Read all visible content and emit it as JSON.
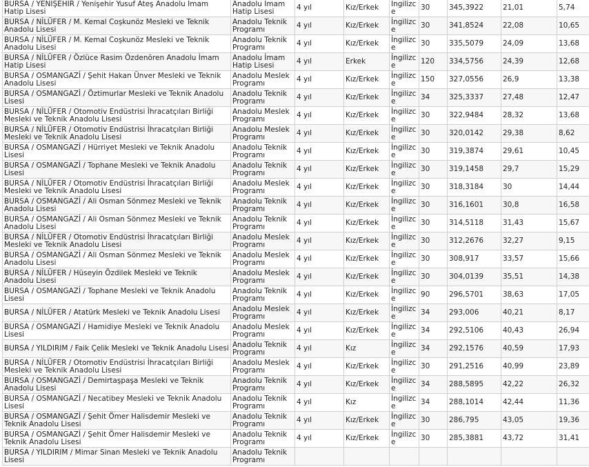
{
  "rows": [
    {
      "school": "BURSA / YENİŞEHİR / Yenişehir Yusuf Ateş Anadolu İmam Hatip Lisesi",
      "type": "Anadolu İmam Hatip Lisesi",
      "duration": "4 yıl",
      "gender": "Kız/Erkek",
      "language": "İngilizce",
      "quota": "30",
      "score": "345,3922",
      "pct1": "21,01",
      "pct2": "5,74"
    },
    {
      "school": "BURSA / NİLÜFER / M. Kemal Coşkunöz Mesleki ve Teknik Anadolu Lisesi",
      "type": "Anadolu Teknik Programı",
      "duration": "4 yıl",
      "gender": "Kız/Erkek",
      "language": "İngilizce",
      "quota": "30",
      "score": "341,8524",
      "pct1": "22,08",
      "pct2": "10,65"
    },
    {
      "school": "BURSA / NİLÜFER / M. Kemal Coşkunöz Mesleki ve Teknik Anadolu Lisesi",
      "type": "Anadolu Teknik Programı",
      "duration": "4 yıl",
      "gender": "Kız/Erkek",
      "language": "İngilizce",
      "quota": "30",
      "score": "335,5079",
      "pct1": "24,09",
      "pct2": "13,68"
    },
    {
      "school": "BURSA / NİLÜFER / Özlüce Rasim Özdenören Anadolu İmam Hatip Lisesi",
      "type": "Anadolu İmam Hatip Lisesi",
      "duration": "4 yıl",
      "gender": "Erkek",
      "language": "İngilizce",
      "quota": "120",
      "score": "334,5756",
      "pct1": "24,39",
      "pct2": "12,68"
    },
    {
      "school": "BURSA / OSMANGAZİ / Şehit Hakan Ünver Mesleki ve Teknik Anadolu Lisesi",
      "type": "Anadolu Meslek Programı",
      "duration": "4 yıl",
      "gender": "Kız/Erkek",
      "language": "İngilizce",
      "quota": "150",
      "score": "327,0556",
      "pct1": "26,9",
      "pct2": "13,38"
    },
    {
      "school": "BURSA / OSMANGAZİ / Öztimurlar Mesleki ve Teknik Anadolu Lisesi",
      "type": "Anadolu Teknik Programı",
      "duration": "4 yıl",
      "gender": "Kız/Erkek",
      "language": "İngilizce",
      "quota": "34",
      "score": "325,3337",
      "pct1": "27,48",
      "pct2": "12,47"
    },
    {
      "school": "BURSA / NİLÜFER / Otomotiv Endüstrisi İhracatçıları Birliği Mesleki ve Teknik Anadolu Lisesi",
      "type": "Anadolu Meslek Programı",
      "duration": "4 yıl",
      "gender": "Kız/Erkek",
      "language": "İngilizce",
      "quota": "30",
      "score": "322,9484",
      "pct1": "28,32",
      "pct2": "13,68"
    },
    {
      "school": "BURSA / NİLÜFER / Otomotiv Endüstrisi İhracatçıları Birliği Mesleki ve Teknik Anadolu Lisesi",
      "type": "Anadolu Meslek Programı",
      "duration": "4 yıl",
      "gender": "Kız/Erkek",
      "language": "İngilizce",
      "quota": "30",
      "score": "320,0142",
      "pct1": "29,38",
      "pct2": "8,62"
    },
    {
      "school": "BURSA / OSMANGAZİ / Hürriyet Mesleki ve Teknik Anadolu Lisesi",
      "type": "Anadolu Teknik Programı",
      "duration": "4 yıl",
      "gender": "Kız/Erkek",
      "language": "İngilizce",
      "quota": "30",
      "score": "319,3874",
      "pct1": "29,61",
      "pct2": "10,45"
    },
    {
      "school": "BURSA / OSMANGAZİ / Tophane Mesleki ve Teknik Anadolu Lisesi",
      "type": "Anadolu Teknik Programı",
      "duration": "4 yıl",
      "gender": "Kız/Erkek",
      "language": "İngilizce",
      "quota": "30",
      "score": "319,1458",
      "pct1": "29,7",
      "pct2": "15,29"
    },
    {
      "school": "BURSA / NİLÜFER / Otomotiv Endüstrisi İhracatçıları Birliği Mesleki ve Teknik Anadolu Lisesi",
      "type": "Anadolu Meslek Programı",
      "duration": "4 yıl",
      "gender": "Kız/Erkek",
      "language": "İngilizce",
      "quota": "30",
      "score": "318,3184",
      "pct1": "30",
      "pct2": "14,44"
    },
    {
      "school": "BURSA / OSMANGAZİ / Ali Osman Sönmez Mesleki ve Teknik Anadolu Lisesi",
      "type": "Anadolu Teknik Programı",
      "duration": "4 yıl",
      "gender": "Kız/Erkek",
      "language": "İngilizce",
      "quota": "30",
      "score": "316,1601",
      "pct1": "30,8",
      "pct2": "16,58"
    },
    {
      "school": "BURSA / OSMANGAZİ / Ali Osman Sönmez Mesleki ve Teknik Anadolu Lisesi",
      "type": "Anadolu Teknik Programı",
      "duration": "4 yıl",
      "gender": "Kız/Erkek",
      "language": "İngilizce",
      "quota": "30",
      "score": "314,5118",
      "pct1": "31,43",
      "pct2": "15,67"
    },
    {
      "school": "BURSA / NİLÜFER / Otomotiv Endüstrisi İhracatçıları Birliği Mesleki ve Teknik Anadolu Lisesi",
      "type": "Anadolu Meslek Programı",
      "duration": "4 yıl",
      "gender": "Kız/Erkek",
      "language": "İngilizce",
      "quota": "30",
      "score": "312,2676",
      "pct1": "32,27",
      "pct2": "9,15"
    },
    {
      "school": "BURSA / OSMANGAZİ / Ali Osman Sönmez Mesleki ve Teknik Anadolu Lisesi",
      "type": "Anadolu Meslek Programı",
      "duration": "4 yıl",
      "gender": "Kız/Erkek",
      "language": "İngilizce",
      "quota": "30",
      "score": "308,917",
      "pct1": "33,57",
      "pct2": "15,66"
    },
    {
      "school": "BURSA / NİLÜFER / Hüseyin Özdilek Mesleki ve Teknik Anadolu Lisesi",
      "type": "Anadolu Meslek Programı",
      "duration": "4 yıl",
      "gender": "Kız/Erkek",
      "language": "İngilizce",
      "quota": "30",
      "score": "304,0139",
      "pct1": "35,51",
      "pct2": "14,38"
    },
    {
      "school": "BURSA / OSMANGAZİ / Tophane Mesleki ve Teknik Anadolu Lisesi",
      "type": "Anadolu Teknik Programı",
      "duration": "4 yıl",
      "gender": "Kız/Erkek",
      "language": "İngilizce",
      "quota": "90",
      "score": "296,5701",
      "pct1": "38,63",
      "pct2": "17,05"
    },
    {
      "school": "BURSA / NİLÜFER / Atatürk Mesleki ve Teknik Anadolu Lisesi",
      "type": "Anadolu Meslek Programı",
      "duration": "4 yıl",
      "gender": "Kız/Erkek",
      "language": "İngilizce",
      "quota": "34",
      "score": "293,006",
      "pct1": "40,21",
      "pct2": "8,17"
    },
    {
      "school": "BURSA / OSMANGAZİ / Hamidiye Mesleki ve Teknik Anadolu Lisesi",
      "type": "Anadolu Meslek Programı",
      "duration": "4 yıl",
      "gender": "Kız/Erkek",
      "language": "İngilizce",
      "quota": "34",
      "score": "292,5106",
      "pct1": "40,43",
      "pct2": "26,94"
    },
    {
      "school": "BURSA / YILDIRIM / Faik Çelik Mesleki ve Teknik Anadolu Lisesi",
      "type": "Anadolu Teknik Programı",
      "duration": "4 yıl",
      "gender": "Kız",
      "language": "İngilizce",
      "quota": "34",
      "score": "292,1576",
      "pct1": "40,59",
      "pct2": "17,93"
    },
    {
      "school": "BURSA / NİLÜFER / Otomotiv Endüstrisi İhracatçıları Birliği Mesleki ve Teknik Anadolu Lisesi",
      "type": "Anadolu Meslek Programı",
      "duration": "4 yıl",
      "gender": "Kız/Erkek",
      "language": "İngilizce",
      "quota": "30",
      "score": "291,2516",
      "pct1": "40,99",
      "pct2": "23,89"
    },
    {
      "school": "BURSA / OSMANGAZİ / Demirtaşpaşa Mesleki ve Teknik Anadolu Lisesi",
      "type": "Anadolu Teknik Programı",
      "duration": "4 yıl",
      "gender": "Kız/Erkek",
      "language": "İngilizce",
      "quota": "34",
      "score": "288,5895",
      "pct1": "42,22",
      "pct2": "26,32"
    },
    {
      "school": "BURSA / OSMANGAZİ / Necatibey Mesleki ve Teknik Anadolu Lisesi",
      "type": "Anadolu Teknik Programı",
      "duration": "4 yıl",
      "gender": "Kız",
      "language": "İngilizce",
      "quota": "34",
      "score": "288,1014",
      "pct1": "42,44",
      "pct2": "11,36"
    },
    {
      "school": "BURSA / OSMANGAZİ / Şehit Ömer Halisdemir Mesleki ve Teknik Anadolu Lisesi",
      "type": "Anadolu Teknik Programı",
      "duration": "4 yıl",
      "gender": "Kız/Erkek",
      "language": "İngilizce",
      "quota": "30",
      "score": "286,795",
      "pct1": "43,05",
      "pct2": "19,36"
    },
    {
      "school": "BURSA / OSMANGAZİ / Şehit Ömer Halisdemir Mesleki ve Teknik Anadolu Lisesi",
      "type": "Anadolu Teknik Programı",
      "duration": "4 yıl",
      "gender": "Kız/Erkek",
      "language": "İngilizce",
      "quota": "30",
      "score": "285,3881",
      "pct1": "43,72",
      "pct2": "31,41"
    },
    {
      "school": "BURSA / YILDIRIM / Mimar Sinan Mesleki ve Teknik Anadolu Lisesi",
      "type": "Anadolu Teknik Programı",
      "duration": "",
      "gender": "",
      "language": "",
      "quota": "",
      "score": "",
      "pct1": "",
      "pct2": ""
    }
  ]
}
